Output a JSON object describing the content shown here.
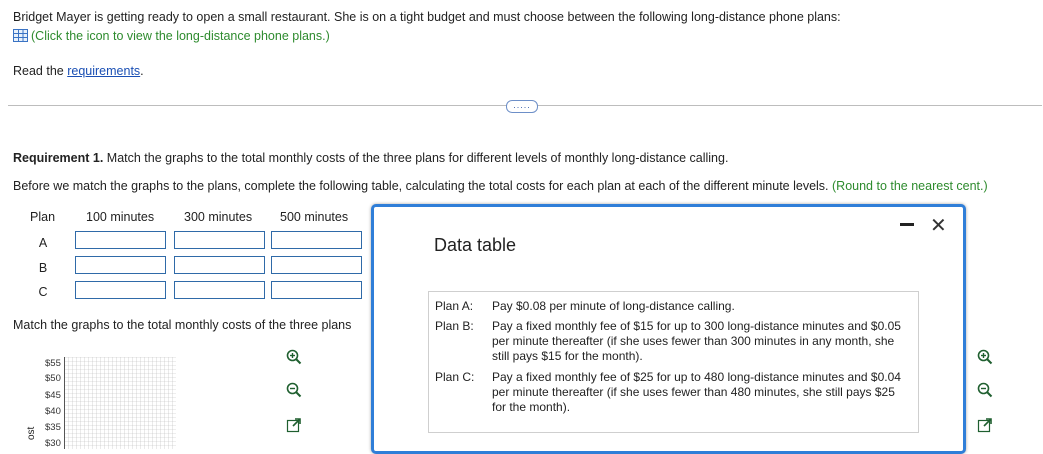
{
  "intro": {
    "problem_text": "Bridget Mayer is getting ready to open a small restaurant. She is on a tight budget and must choose between the following long-distance phone plans:",
    "click_icon_text": "(Click the icon to view the long-distance phone plans.)",
    "read_prefix": "Read the ",
    "requirements_link": "requirements",
    "read_suffix": "."
  },
  "divider": {
    "button_label": "....."
  },
  "requirement": {
    "heading_bold": "Requirement 1.",
    "heading_text": " Match the graphs to the total monthly costs of the three plans for different levels of monthly long-distance calling.",
    "instruction": "Before we match the graphs to the plans, complete the following table, calculating the total costs for each plan at each of the different minute levels.",
    "round_note": "(Round to the nearest cent.)"
  },
  "table": {
    "headers": [
      "Plan",
      "100 minutes",
      "300 minutes",
      "500 minutes"
    ],
    "rows": [
      {
        "label": "A",
        "values": [
          "",
          "",
          ""
        ]
      },
      {
        "label": "B",
        "values": [
          "",
          "",
          ""
        ]
      },
      {
        "label": "C",
        "values": [
          "",
          "",
          ""
        ]
      }
    ]
  },
  "match_text": "Match the graphs to the total monthly costs of the three plans",
  "graph": {
    "y_ticks": [
      "$55",
      "$50",
      "$45",
      "$40",
      "$35",
      "$30"
    ],
    "y_axis_label": "ost"
  },
  "modal": {
    "title": "Data table",
    "minimize_icon": "minimize-icon",
    "close_symbol": "✕",
    "plans": [
      {
        "key": "Plan A:",
        "text": "Pay $0.08 per minute of long-distance calling."
      },
      {
        "key": "Plan B:",
        "text": "Pay a fixed monthly fee of $15 for up to 300 long-distance minutes and $0.05 per minute thereafter (if she uses fewer than 300 minutes in any month, she still pays $15 for the month)."
      },
      {
        "key": "Plan C:",
        "text": "Pay a fixed monthly fee of $25 for up to 480 long-distance minutes and $0.04 per minute thereafter (if she uses fewer than 480 minutes, she still pays $25 for the month)."
      }
    ]
  },
  "colors": {
    "accent": "#2f7ed8",
    "green_note": "#2e8b2e",
    "link": "#1a4fb4",
    "input_border": "#2f6aa8"
  }
}
